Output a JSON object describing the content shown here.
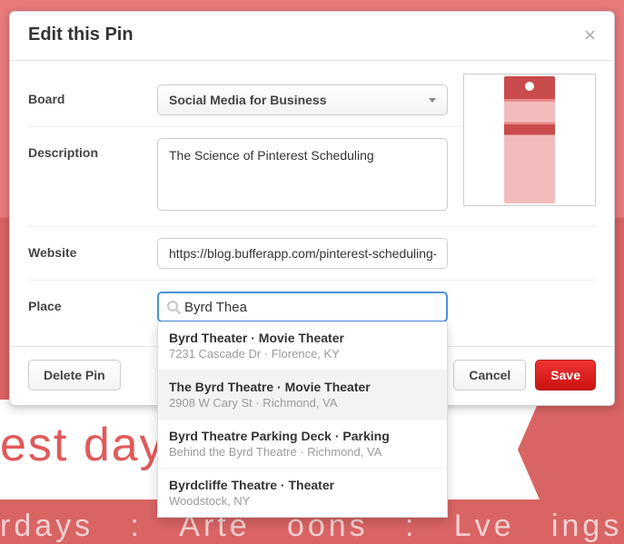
{
  "modal": {
    "title": "Edit this Pin",
    "labels": {
      "board": "Board",
      "description": "Description",
      "website": "Website",
      "place": "Place"
    },
    "board_selected": "Social Media for Business",
    "description_value": "The Science of Pinterest Scheduling",
    "website_value": "https://blog.bufferapp.com/pinterest-scheduling-",
    "place_query": "Byrd Thea",
    "buttons": {
      "delete": "Delete Pin",
      "cancel": "Cancel",
      "save": "Save"
    }
  },
  "suggestions": [
    {
      "title": "Byrd Theater · Movie Theater",
      "sub": "7231 Cascade Dr · Florence, KY",
      "active": false
    },
    {
      "title": "The Byrd Theatre · Movie Theater",
      "sub": "2908 W Cary St · Richmond, VA",
      "active": true
    },
    {
      "title": "Byrd Theatre Parking Deck · Parking",
      "sub": "Behind the Byrd Theatre · Richmond, VA",
      "active": false
    },
    {
      "title": "Byrdcliffe Theatre · Theater",
      "sub": "Woodstock, NY",
      "active": false
    }
  ]
}
